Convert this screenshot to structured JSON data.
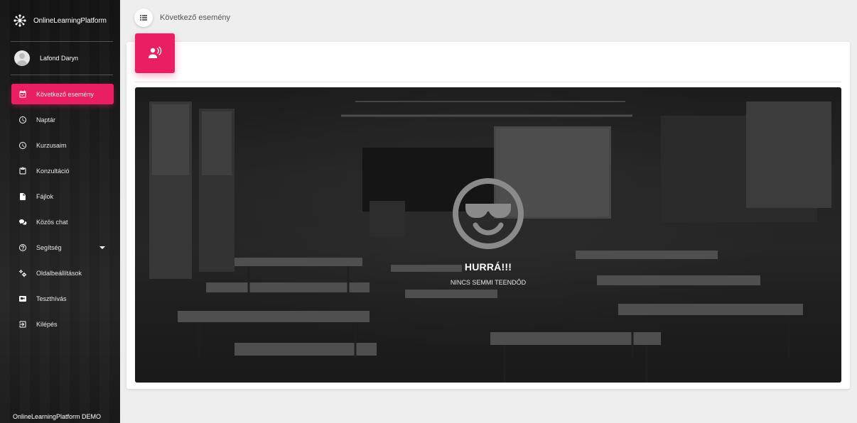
{
  "brand": {
    "name": "OnlineLearningPlatform"
  },
  "user": {
    "name": "Lafond Daryn"
  },
  "nav": [
    {
      "label": "Következő esemény",
      "icon": "calendar-check-icon",
      "active": true
    },
    {
      "label": "Naptár",
      "icon": "clock-icon"
    },
    {
      "label": "Kurzusaim",
      "icon": "clock-icon"
    },
    {
      "label": "Konzultáció",
      "icon": "clipboard-icon"
    },
    {
      "label": "Fájlok",
      "icon": "file-icon"
    },
    {
      "label": "Közös chat",
      "icon": "chat-icon"
    },
    {
      "label": "Segítség",
      "icon": "help-icon",
      "has_caret": true
    },
    {
      "label": "Oldalbeállítások",
      "icon": "settings-icon"
    },
    {
      "label": "Teszthívás",
      "icon": "video-icon"
    },
    {
      "label": "Kilépés",
      "icon": "logout-icon"
    }
  ],
  "footer": {
    "text": "OnlineLearningPlatform DEMO"
  },
  "header": {
    "title": "Következő esemény",
    "menu_icon": "view-list-icon"
  },
  "card": {
    "icon": "lecture-icon",
    "hero": {
      "icon": "sunglasses-smiley-icon",
      "title": "HURRÁ!!!",
      "subtitle": "NINCS SEMMI TEENDŐD"
    }
  },
  "colors": {
    "accent": "#e91e63",
    "sidebar_bg": "#1e1e1e",
    "page_bg": "#eeeeee"
  }
}
